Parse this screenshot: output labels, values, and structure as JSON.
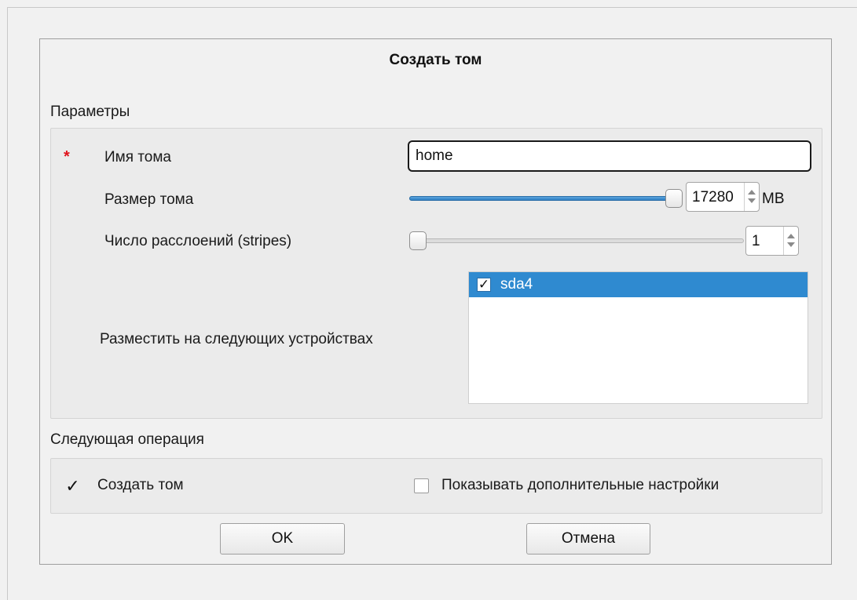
{
  "dialog": {
    "title": "Создать том"
  },
  "parameters": {
    "group_label": "Параметры",
    "volume_name": {
      "label": "Имя тома",
      "value": "home",
      "required": true
    },
    "volume_size": {
      "label": "Размер тома",
      "value": "17280",
      "unit": "MB",
      "slider_fraction": 1.0
    },
    "stripes": {
      "label": "Число расслоений (stripes)",
      "value": "1",
      "slider_fraction": 0.0
    },
    "devices": {
      "label": "Разместить на следующих устройствах",
      "items": [
        {
          "name": "sda4",
          "checked": true,
          "selected": true
        }
      ]
    }
  },
  "next_operation": {
    "group_label": "Следующая операция",
    "create_volume": {
      "label": "Создать том",
      "checked": true
    },
    "show_advanced": {
      "label": "Показывать дополнительные настройки",
      "checked": false
    }
  },
  "buttons": {
    "ok": "OK",
    "cancel": "Отмена"
  },
  "colors": {
    "required_mark": "#e0121b",
    "selection": "#2f8ad0",
    "slider_fill": "#3a8fd0"
  }
}
